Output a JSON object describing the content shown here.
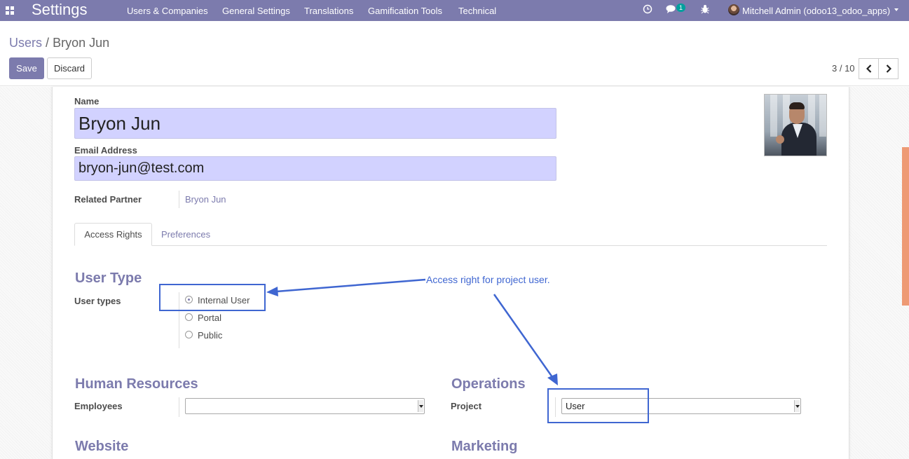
{
  "navbar": {
    "brand": "Settings",
    "menu": [
      "Users & Companies",
      "General Settings",
      "Translations",
      "Gamification Tools",
      "Technical"
    ],
    "chat_badge": "1",
    "user": "Mitchell Admin (odoo13_odoo_apps)"
  },
  "breadcrumb": {
    "parent": "Users",
    "separator": "/",
    "current": "Bryon Jun"
  },
  "actions": {
    "save": "Save",
    "discard": "Discard"
  },
  "pager": {
    "text": "3 / 10"
  },
  "form": {
    "name_label": "Name",
    "name_value": "Bryon Jun",
    "email_label": "Email Address",
    "email_value": "bryon-jun@test.com",
    "partner_label": "Related Partner",
    "partner_value": "Bryon Jun"
  },
  "tabs": [
    "Access Rights",
    "Preferences"
  ],
  "user_type": {
    "title": "User Type",
    "label": "User types",
    "options": [
      "Internal User",
      "Portal",
      "Public"
    ],
    "selected": "Internal User"
  },
  "groups": {
    "hr_title": "Human Resources",
    "employees_label": "Employees",
    "employees_value": "",
    "ops_title": "Operations",
    "project_label": "Project",
    "project_value": "User",
    "website_title": "Website",
    "marketing_title": "Marketing"
  },
  "annotation": {
    "text": "Access right for project user.",
    "color": "#3f66d1"
  },
  "colors": {
    "brand": "#7c7bad",
    "input_highlight": "#d2d2ff"
  }
}
